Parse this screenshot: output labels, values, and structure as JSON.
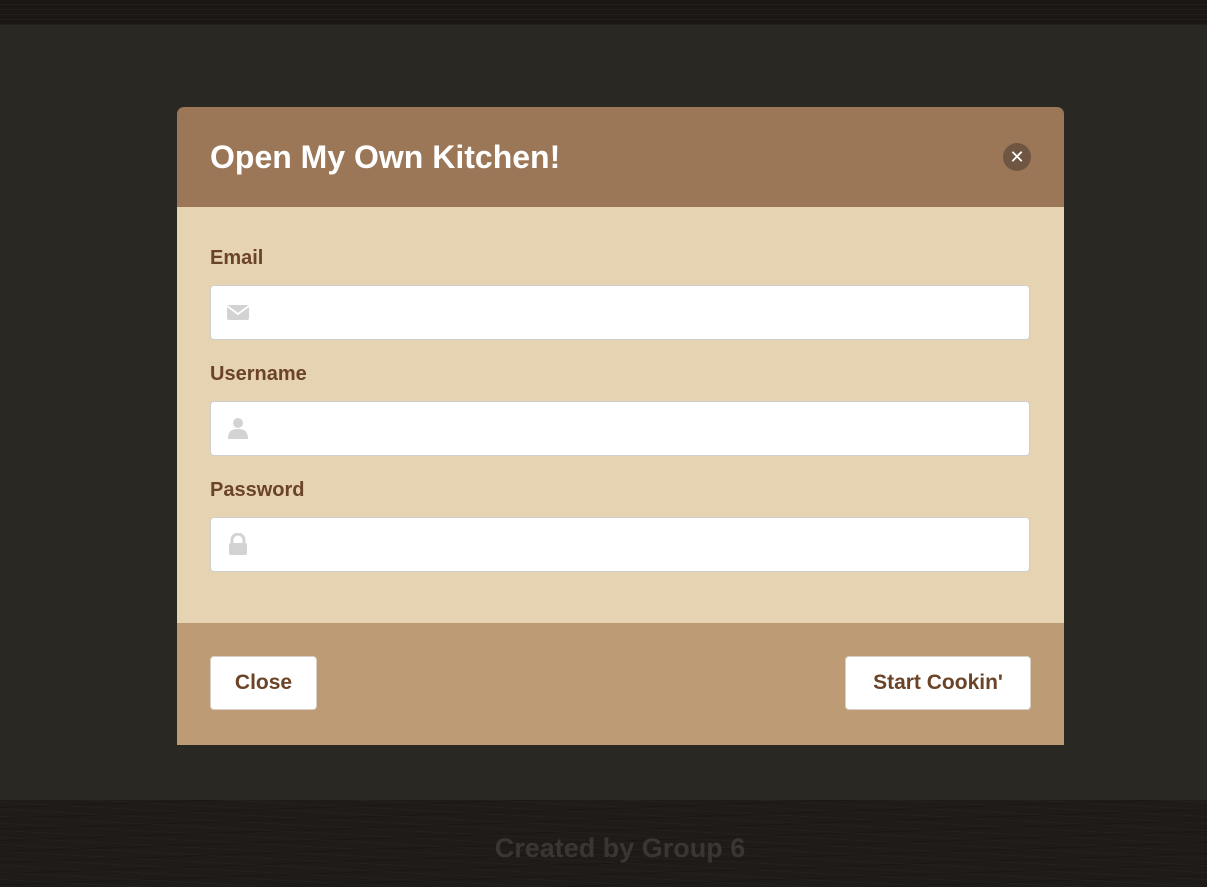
{
  "modal": {
    "title": "Open My Own Kitchen!",
    "close_icon": "times-icon",
    "fields": [
      {
        "label": "Email",
        "icon": "envelope-icon",
        "value": "",
        "placeholder": ""
      },
      {
        "label": "Username",
        "icon": "user-icon",
        "value": "",
        "placeholder": ""
      },
      {
        "label": "Password",
        "icon": "lock-icon",
        "value": "",
        "placeholder": ""
      }
    ],
    "buttons": {
      "close_label": "Close",
      "submit_label": "Start Cookin'"
    }
  },
  "footer": {
    "text": "Created by Group 6"
  },
  "colors": {
    "header": "#9b7757",
    "body": "#e5d3b2",
    "footer": "#bc9b75",
    "label_text": "#6b4327",
    "backdrop": "#292823"
  }
}
